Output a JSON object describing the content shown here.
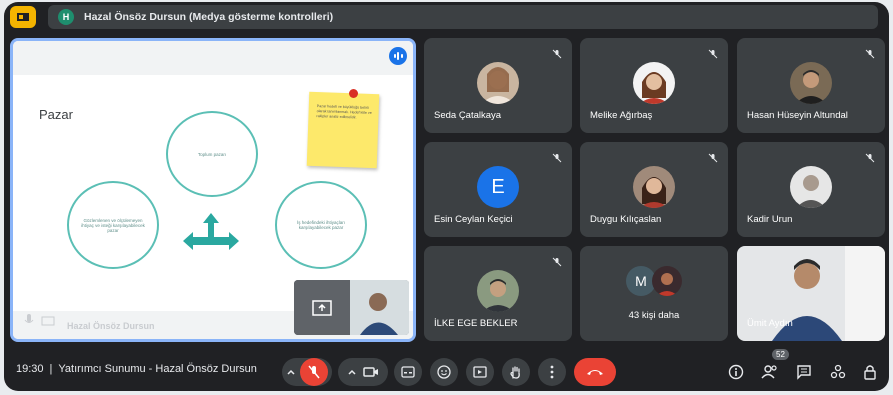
{
  "topbar": {
    "presenter_initial": "H",
    "presenting_text": "Hazal Önsöz Dursun (Medya gösterme kontrolleri)"
  },
  "slide": {
    "title": "Pazar",
    "circles": [
      "Toplum pazarı",
      "Gözlemlenen ve ölçülemeyen ihtiyaç ve isteği karşılayabilecek pazar",
      "İş hedefindeki ihtiyaçları karşılayabilecek pazar"
    ],
    "sticky_text": "Pazar hedefi ve büyüklüğü belirli olarak tanımlanmalı. Hedef kitle ve rakipler analiz edilmelidir.",
    "presenter_name": "Hazal Önsöz Dursun"
  },
  "participants": [
    {
      "name": "Seda Çatalkaya"
    },
    {
      "name": "Melike Ağırbaş"
    },
    {
      "name": "Hasan Hüseyin Altundal"
    },
    {
      "name": "Esin Ceylan Keçici",
      "initial": "E"
    },
    {
      "name": "Duygu Kılıçaslan"
    },
    {
      "name": "Kadir Urun"
    },
    {
      "name": "İLKE EGE BEKLER"
    },
    {
      "name": "43 kişi daha",
      "initial": "M"
    },
    {
      "name": "Ümit Aydın"
    }
  ],
  "bottombar": {
    "time": "19:30",
    "meeting_title": "Yatırımcı Sunumu - Hazal Önsöz Dursun",
    "people_count": "52"
  },
  "colors": {
    "background": "#202124",
    "tile": "#3c4043",
    "accent_blue": "#8ab4f8",
    "end_call_red": "#ea4335",
    "slide_teal": "#5bbfb5"
  }
}
